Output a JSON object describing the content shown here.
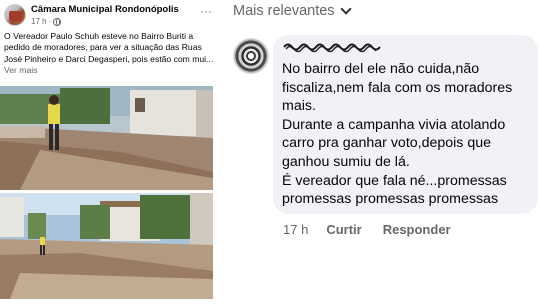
{
  "post": {
    "page_name": "Câmara Municipal Rondonópolis",
    "time": "17 h",
    "dot": "·",
    "more_icon": "···",
    "text": "O Vereador Paulo Schuh esteve no Bairro Buriti a pedido de moradores, para ver a situação das Ruas José Pinheiro e Darci Degasperi, pois estão com mui...",
    "see_more": "Ver mais"
  },
  "comments": {
    "sort_label": "Mais relevantes",
    "comment": {
      "lines": [
        "No bairro del ele não cuida,não fiscaliza,nem fala com os moradores mais.",
        "Durante a campanha vivia atolando carro pra ganhar voto,depois que ganhou sumiu de lá.",
        "É vereador que fala né...promessas promessas promessas promessas"
      ],
      "time": "17 h",
      "like_label": "Curtir",
      "reply_label": "Responder"
    }
  },
  "colors": {
    "secondary_text": "#65676b",
    "bubble_bg": "#f0f2f5",
    "primary_text": "#050505"
  }
}
